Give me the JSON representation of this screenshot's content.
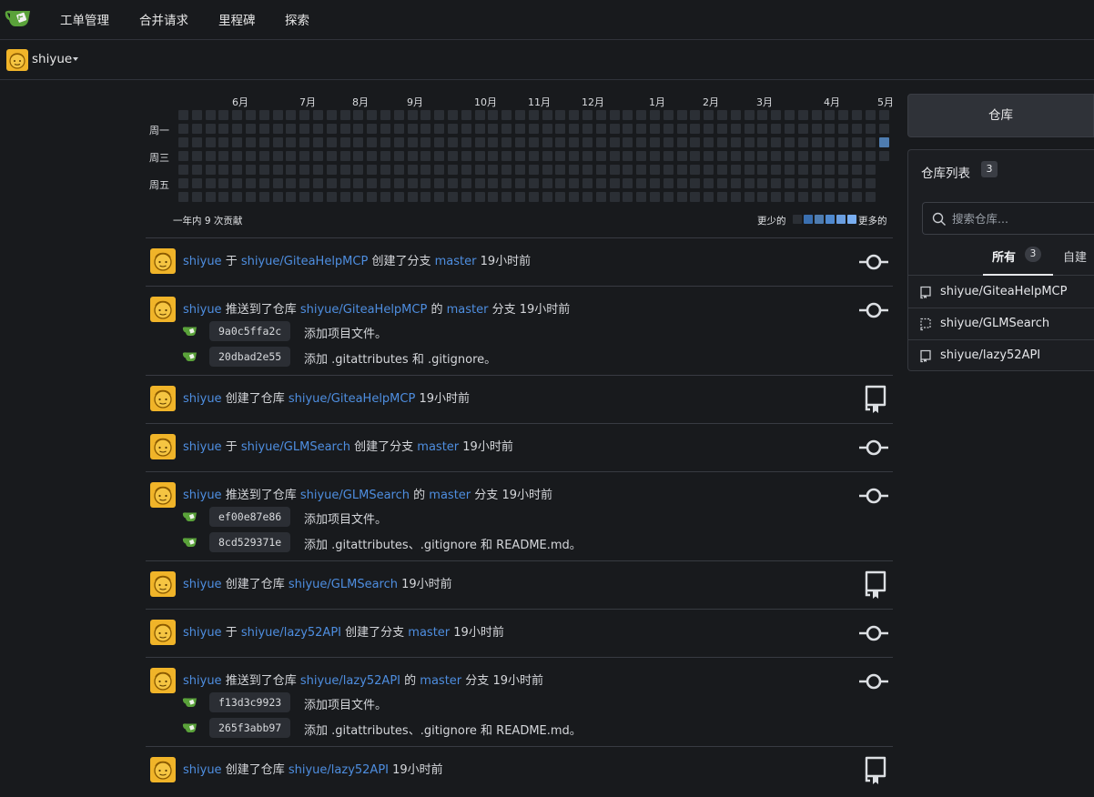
{
  "nav": {
    "items": [
      "工单管理",
      "合并请求",
      "里程碑",
      "探索"
    ]
  },
  "context": {
    "user": "shiyue"
  },
  "heatmap": {
    "months": [
      "6月",
      "7月",
      "8月",
      "9月",
      "10月",
      "11月",
      "12月",
      "1月",
      "2月",
      "3月",
      "4月",
      "5月"
    ],
    "days": [
      "周一",
      "周三",
      "周五"
    ],
    "total": "一年内 9 次贡献",
    "less": "更少的",
    "more": "更多的",
    "colors": {
      "empty": "#2b2f35",
      "level1": "#4e7cb0",
      "level2": "#3a6fb0",
      "level3": "#4f89cf",
      "level4": "#79aef0"
    }
  },
  "feed": [
    {
      "user": "shiyue",
      "type": "branch",
      "pre": "于",
      "repo": "shiyue/GiteaHelpMCP",
      "mid": "创建了分支",
      "branch": "master",
      "post": "",
      "time": "19小时前"
    },
    {
      "user": "shiyue",
      "type": "push",
      "pre": "推送到了仓库",
      "repo": "shiyue/GiteaHelpMCP",
      "mid": "的",
      "branch": "master",
      "post": "分支",
      "time": "19小时前",
      "commits": [
        {
          "sha": "9a0c5ffa2c",
          "msg": "添加项目文件。"
        },
        {
          "sha": "20dbad2e55",
          "msg": "添加 .gitattributes 和 .gitignore。"
        }
      ]
    },
    {
      "user": "shiyue",
      "type": "repo",
      "pre": "创建了仓库",
      "repo": "shiyue/GiteaHelpMCP",
      "mid": "",
      "branch": "",
      "post": "",
      "time": "19小时前"
    },
    {
      "user": "shiyue",
      "type": "branch",
      "pre": "于",
      "repo": "shiyue/GLMSearch",
      "mid": "创建了分支",
      "branch": "master",
      "post": "",
      "time": "19小时前"
    },
    {
      "user": "shiyue",
      "type": "push",
      "pre": "推送到了仓库",
      "repo": "shiyue/GLMSearch",
      "mid": "的",
      "branch": "master",
      "post": "分支",
      "time": "19小时前",
      "commits": [
        {
          "sha": "ef00e87e86",
          "msg": "添加项目文件。"
        },
        {
          "sha": "8cd529371e",
          "msg": "添加 .gitattributes、.gitignore 和 README.md。"
        }
      ]
    },
    {
      "user": "shiyue",
      "type": "repo",
      "pre": "创建了仓库",
      "repo": "shiyue/GLMSearch",
      "mid": "",
      "branch": "",
      "post": "",
      "time": "19小时前"
    },
    {
      "user": "shiyue",
      "type": "branch",
      "pre": "于",
      "repo": "shiyue/lazy52API",
      "mid": "创建了分支",
      "branch": "master",
      "post": "",
      "time": "19小时前"
    },
    {
      "user": "shiyue",
      "type": "push",
      "pre": "推送到了仓库",
      "repo": "shiyue/lazy52API",
      "mid": "的",
      "branch": "master",
      "post": "分支",
      "time": "19小时前",
      "commits": [
        {
          "sha": "f13d3c9923",
          "msg": "添加项目文件。"
        },
        {
          "sha": "265f3abb97",
          "msg": "添加 .gitattributes、.gitignore 和 README.md。"
        }
      ]
    },
    {
      "user": "shiyue",
      "type": "repo",
      "pre": "创建了仓库",
      "repo": "shiyue/lazy52API",
      "mid": "",
      "branch": "",
      "post": "",
      "time": "19小时前"
    }
  ],
  "sidebar": {
    "repo_button": "仓库",
    "title": "仓库列表",
    "count": "3",
    "search_placeholder": "搜索仓库...",
    "tab_all": "所有",
    "tab_all_count": "3",
    "tab_own": "自建",
    "repos": [
      {
        "name": "shiyue/GiteaHelpMCP",
        "icon": "repo-icon"
      },
      {
        "name": "shiyue/GLMSearch",
        "icon": "repo-template-icon"
      },
      {
        "name": "shiyue/lazy52API",
        "icon": "repo-icon"
      }
    ]
  }
}
